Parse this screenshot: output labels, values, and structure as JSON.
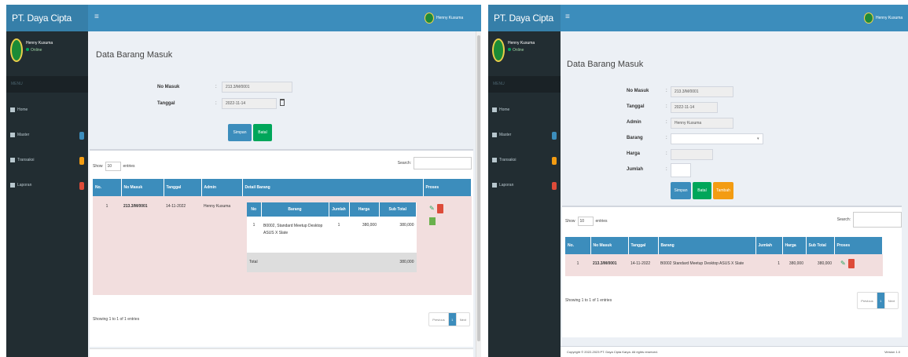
{
  "app": {
    "brand": "PT. Daya Cipta Karya",
    "hamburger": "≡",
    "user": "Henny Kusuma",
    "status": "Online",
    "nav_header": "MENU"
  },
  "menu": [
    {
      "label": "Home",
      "icon": "home-icon"
    },
    {
      "label": "Master",
      "icon": "folder-icon",
      "badge_color": "#3c8dbc"
    },
    {
      "label": "Transaksi",
      "icon": "exchange-icon",
      "badge_color": "#f39c12"
    },
    {
      "label": "Laporan",
      "icon": "file-icon",
      "badge_color": "#dd4b39"
    }
  ],
  "left": {
    "title": "Data Barang Masuk",
    "form": {
      "no_masuk_label": "No Masuk",
      "no_masuk_value": "213.3/M/0001",
      "tanggal_label": "Tanggal",
      "tanggal_value": "2022-11-14",
      "sep": ":"
    },
    "buttons": {
      "simpan": "Simpan",
      "batal": "Batal"
    },
    "show": "Show",
    "entries_value": "10",
    "entries": "entries",
    "search": "Search:",
    "table": {
      "headers": [
        "No.",
        "No Masuk",
        "Tanggal",
        "Admin",
        "Detail Barang",
        "Proses"
      ],
      "rows": [
        {
          "no": "1",
          "no_masuk": "213.3/M/0001",
          "tanggal": "14-11-2022",
          "admin": "Henny Kusuma"
        }
      ]
    },
    "inner": {
      "headers": [
        "No",
        "Barang",
        "Jumlah",
        "Harga",
        "Sub Total"
      ],
      "rows": [
        {
          "no": "1",
          "barang": "B0002, Standard Meetup Desktop ASUS X Slate",
          "jumlah": "1",
          "harga": "380,000",
          "subtotal": "380,000"
        }
      ],
      "total_label": "Total",
      "total_value": "380,000"
    },
    "info": "Showing 1 to 1 of 1 entries",
    "pager": {
      "prev": "Previous",
      "page": "1",
      "next": "Next"
    }
  },
  "right": {
    "title": "Data Barang Masuk",
    "form": {
      "no_masuk_label": "No Masuk",
      "no_masuk_value": "213.3/M/0001",
      "tanggal_label": "Tanggal",
      "tanggal_value": "2022-11-14",
      "admin_label": "Admin",
      "admin_value": "Henny Kusuma",
      "barang_label": "Barang",
      "harga_label": "Harga",
      "jumlah_label": "Jumlah",
      "sep": ":"
    },
    "buttons": {
      "simpan": "Simpan",
      "batal": "Batal",
      "tambah": "Tambah"
    },
    "show": "Show",
    "entries_value": "10",
    "entries": "entries",
    "search": "Search:",
    "table": {
      "headers": [
        "No.",
        "No Masuk",
        "Tanggal",
        "Barang",
        "Jumlah",
        "Harga",
        "Sub Total",
        "Proses"
      ],
      "rows": [
        {
          "no": "1",
          "no_masuk": "213.3/M/0001",
          "tanggal": "14-11-2022",
          "barang": "B0002 Standard Meetup Desktop ASUS X Slate",
          "jumlah": "1",
          "harga": "380,000",
          "subtotal": "380,000"
        }
      ]
    },
    "info": "Showing 1 to 1 of 1 entries",
    "pager": {
      "prev": "Previous",
      "page": "1",
      "next": "Next"
    },
    "footer": "Copyright © 2022-2023 PT. Daya Cipta Karya. All rights reserved.",
    "version": "Version 1.0"
  }
}
